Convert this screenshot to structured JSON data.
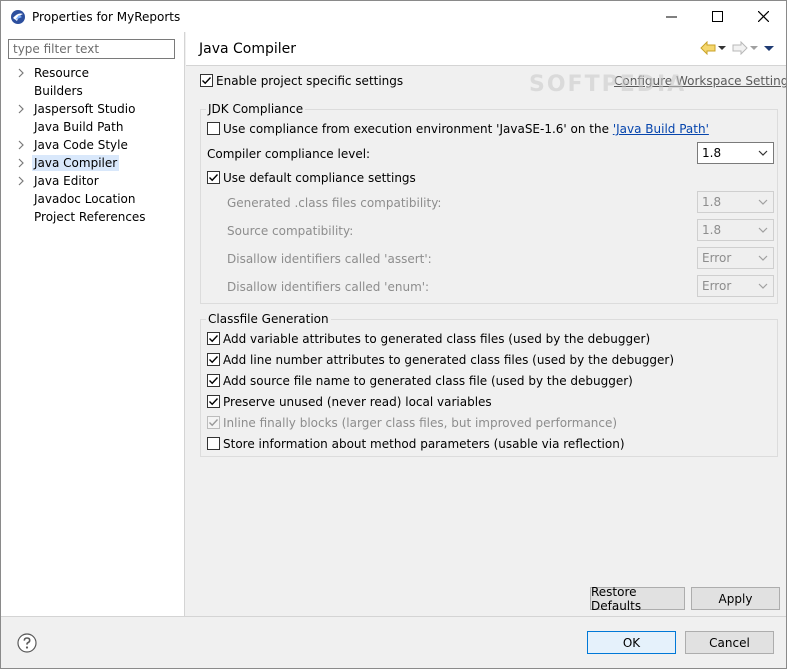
{
  "window": {
    "title": "Properties for MyReports"
  },
  "filter": {
    "placeholder": "type filter text"
  },
  "tree": {
    "items": [
      {
        "label": "Resource",
        "expandable": true
      },
      {
        "label": "Builders",
        "expandable": false
      },
      {
        "label": "Jaspersoft Studio",
        "expandable": true
      },
      {
        "label": "Java Build Path",
        "expandable": false
      },
      {
        "label": "Java Code Style",
        "expandable": true
      },
      {
        "label": "Java Compiler",
        "expandable": true,
        "selected": true
      },
      {
        "label": "Java Editor",
        "expandable": true
      },
      {
        "label": "Javadoc Location",
        "expandable": false
      },
      {
        "label": "Project References",
        "expandable": false
      }
    ]
  },
  "page": {
    "title": "Java Compiler",
    "enable_specific": "Enable project specific settings",
    "configure_link": "Configure Workspace Settings..."
  },
  "jdk": {
    "group_title": "JDK Compliance",
    "use_env_prefix": "Use compliance from execution environment 'JavaSE-1.6' on the ",
    "use_env_link": "'Java Build Path'",
    "compliance_label": "Compiler compliance level:",
    "compliance_value": "1.8",
    "use_default": "Use default compliance settings",
    "generated_label": "Generated .class files compatibility:",
    "generated_value": "1.8",
    "source_label": "Source compatibility:",
    "source_value": "1.8",
    "assert_label": "Disallow identifiers called 'assert':",
    "assert_value": "Error",
    "enum_label": "Disallow identifiers called 'enum':",
    "enum_value": "Error"
  },
  "classfile": {
    "group_title": "Classfile Generation",
    "options": [
      {
        "label": "Add variable attributes to generated class files (used by the debugger)",
        "checked": true,
        "enabled": true
      },
      {
        "label": "Add line number attributes to generated class files (used by the debugger)",
        "checked": true,
        "enabled": true
      },
      {
        "label": "Add source file name to generated class file (used by the debugger)",
        "checked": true,
        "enabled": true
      },
      {
        "label": "Preserve unused (never read) local variables",
        "checked": true,
        "enabled": true
      },
      {
        "label": "Inline finally blocks (larger class files, but improved performance)",
        "checked": true,
        "enabled": false
      },
      {
        "label": "Store information about method parameters (usable via reflection)",
        "checked": false,
        "enabled": true
      }
    ]
  },
  "buttons": {
    "restore_defaults": "Restore Defaults",
    "apply": "Apply",
    "ok": "OK",
    "cancel": "Cancel"
  },
  "watermark": "SOFTPEDIA",
  "colors": {
    "accent": "#0078d7",
    "link": "#0645ad",
    "selection": "#d9e8fb"
  }
}
